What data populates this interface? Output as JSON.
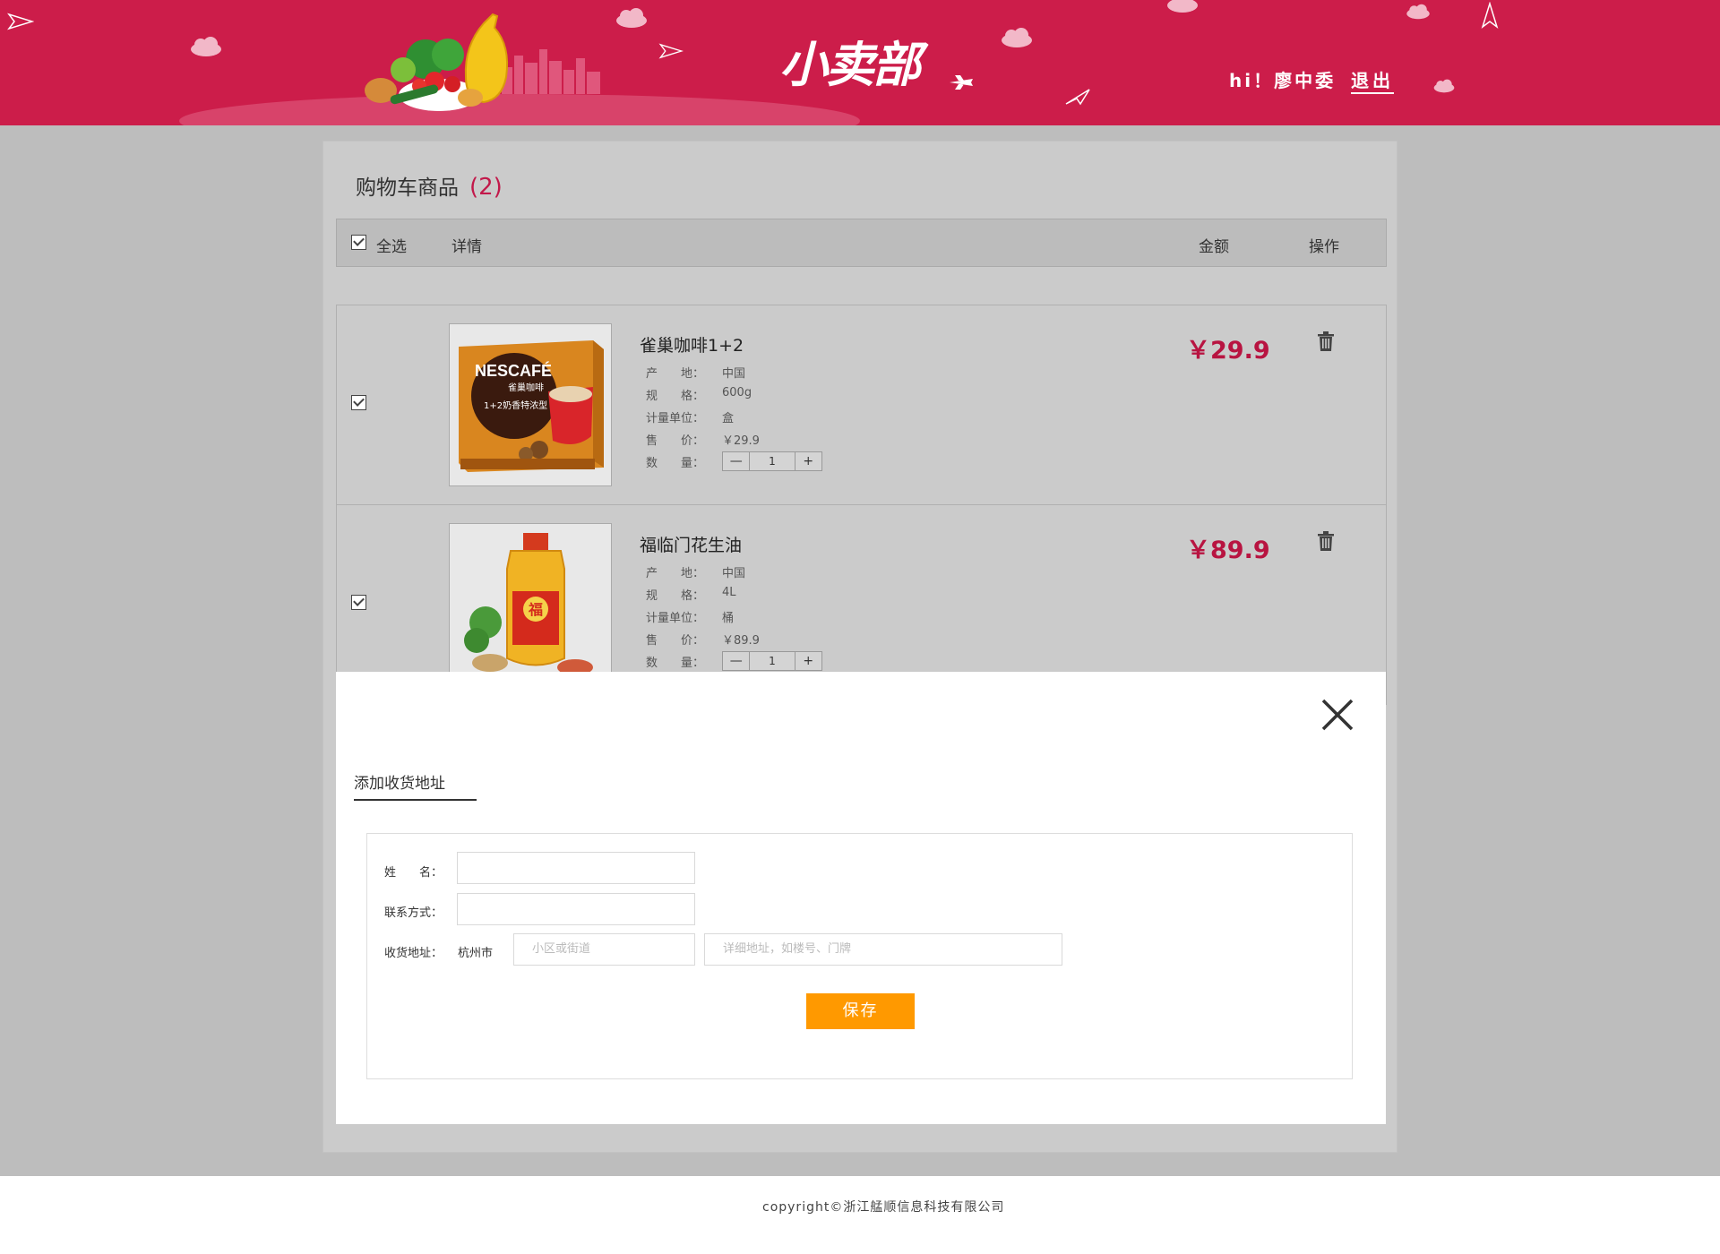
{
  "header": {
    "brand": "小卖部",
    "greeting": "hi！廖中委",
    "logout_label": "退出"
  },
  "cart": {
    "title": "购物车商品",
    "count": "(2)",
    "columns": {
      "select_all": "全选",
      "details": "详情",
      "amount": "金额",
      "actions": "操作"
    },
    "attr_labels": {
      "origin": "产　　地：",
      "spec": "规　　格：",
      "unit": "计量单位：",
      "price": "售　　价：",
      "qty": "数　　量："
    },
    "items": [
      {
        "name": "雀巢咖啡1+2",
        "origin": "中国",
        "spec": "600g",
        "unit": "盒",
        "unit_price": "￥29.9",
        "quantity": "1",
        "minus": "—",
        "plus": "+",
        "total": "￥29.9",
        "checked": true,
        "thumb_brand": "NESCAFÉ",
        "thumb_sub": "雀巢咖啡",
        "thumb_line": "1+2奶香特浓型"
      },
      {
        "name": "福临门花生油",
        "origin": "中国",
        "spec": "4L",
        "unit": "桶",
        "unit_price": "￥89.9",
        "quantity": "1",
        "minus": "—",
        "plus": "+",
        "total": "￥89.9",
        "checked": true,
        "thumb_brand": "福"
      }
    ]
  },
  "address_modal": {
    "title": "添加收货地址",
    "close_icon": "close-icon",
    "name_label": "姓　　名：",
    "contact_label": "联系方式：",
    "address_label": "收货地址：",
    "city": "杭州市",
    "street_placeholder": "小区或街道",
    "detail_placeholder": "详细地址，如楼号、门牌",
    "save_label": "保存"
  },
  "footer": {
    "copyright": "copyright©浙江艋顺信息科技有限公司"
  },
  "colors": {
    "header_bg": "#cc1d4a",
    "price": "#b81441",
    "save_button": "#ff9900",
    "page_bg": "#bdbdbd"
  }
}
